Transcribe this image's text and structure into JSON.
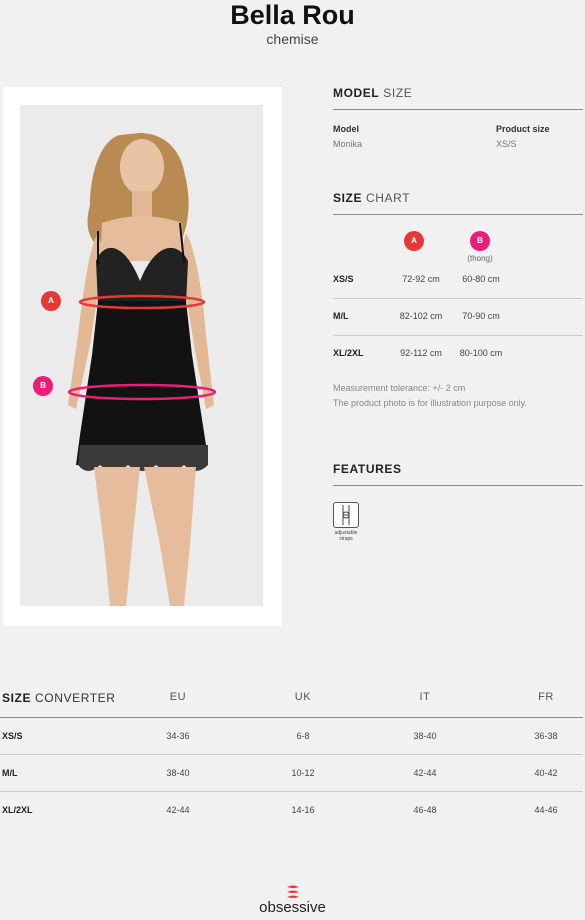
{
  "product": {
    "name": "Bella Rou",
    "type": "chemise"
  },
  "photo": {
    "marker_a": "A",
    "marker_b": "B",
    "colors": {
      "a": "#e53935",
      "b": "#e91e78"
    }
  },
  "model_size": {
    "title_bold": "MODEL",
    "title_light": "SIZE",
    "model_label": "Model",
    "model_value": "Monika",
    "product_size_label": "Product size",
    "product_size_value": "XS/S"
  },
  "size_chart": {
    "title_bold": "SIZE",
    "title_light": "CHART",
    "col_a": "A",
    "col_b": "B",
    "col_b_note": "(thong)",
    "rows": [
      {
        "size": "XS/S",
        "a": "72-92 cm",
        "b": "60-80 cm"
      },
      {
        "size": "M/L",
        "a": "82-102 cm",
        "b": "70-90 cm"
      },
      {
        "size": "XL/2XL",
        "a": "92-112 cm",
        "b": "80-100 cm"
      }
    ],
    "note_1": "Measurement tolerance: +/- 2 cm",
    "note_2": "The product photo is for illustration purpose only."
  },
  "features": {
    "title": "FEATURES",
    "items": [
      {
        "icon": "adjustable-straps-icon",
        "label_1": "adjustable",
        "label_2": "straps"
      }
    ]
  },
  "size_converter": {
    "title_bold": "SIZE",
    "title_light": "CONVERTER",
    "columns": [
      "EU",
      "UK",
      "IT",
      "FR"
    ],
    "rows": [
      {
        "size": "XS/S",
        "values": [
          "34-36",
          "6-8",
          "38-40",
          "36-38"
        ]
      },
      {
        "size": "M/L",
        "values": [
          "38-40",
          "10-12",
          "42-44",
          "40-42"
        ]
      },
      {
        "size": "XL/2XL",
        "values": [
          "42-44",
          "14-16",
          "46-48",
          "44-46"
        ]
      }
    ]
  },
  "brand": {
    "name": "obsessive",
    "color": "#e53935"
  }
}
